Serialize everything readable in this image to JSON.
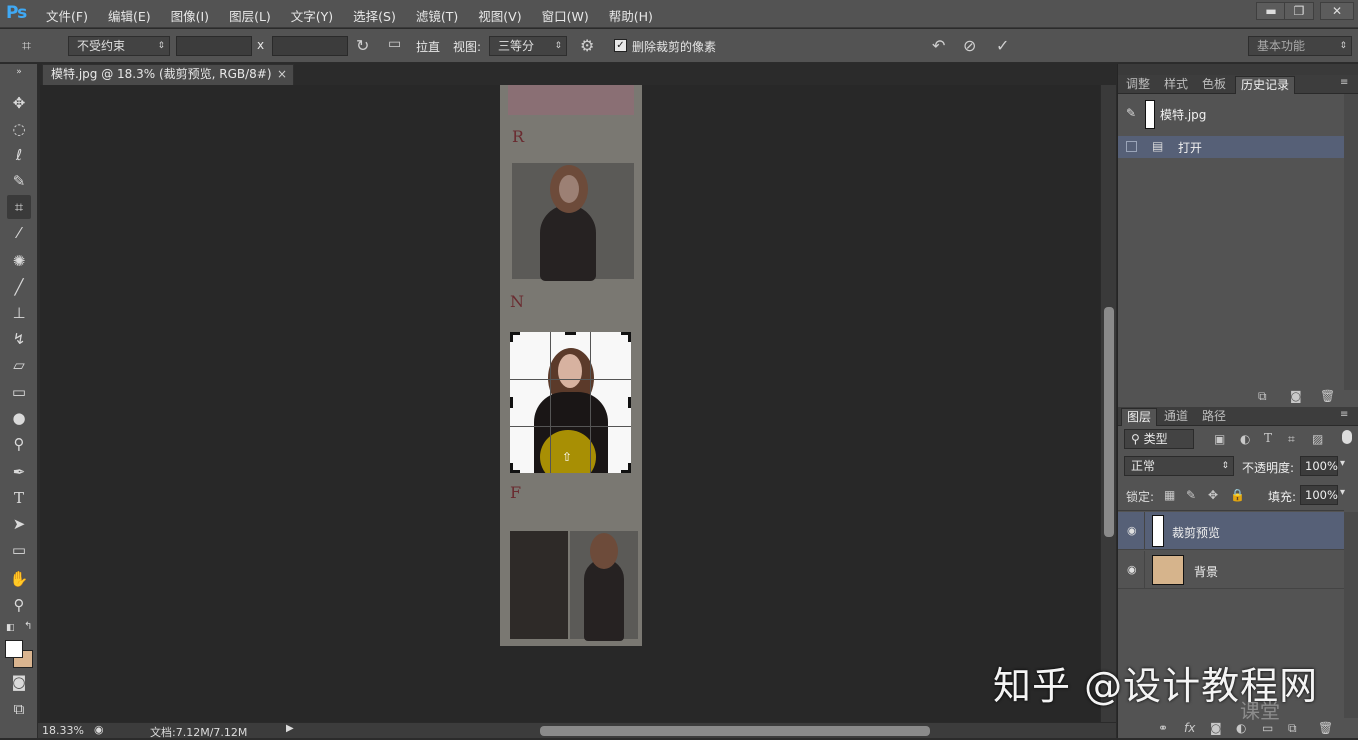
{
  "app": {
    "logo": "Ps"
  },
  "menu": [
    "文件(F)",
    "编辑(E)",
    "图像(I)",
    "图层(L)",
    "文字(Y)",
    "选择(S)",
    "滤镜(T)",
    "视图(V)",
    "窗口(W)",
    "帮助(H)"
  ],
  "window_controls": {
    "minimize": "▬",
    "restore": "❐",
    "close": "✕"
  },
  "options": {
    "ratio_select": "不受约束",
    "width_value": "",
    "separator": "x",
    "height_value": "",
    "straighten_label": "拉直",
    "view_label": "视图:",
    "view_select": "三等分",
    "delete_cropped_label": "删除裁剪的像素",
    "workspace_select": "基本功能"
  },
  "document": {
    "tab_title": "模特.jpg @ 18.3% (裁剪预览, RGB/8#)",
    "tab_close": "×"
  },
  "status": {
    "zoom": "18.33%",
    "doc_info": "文档:7.12M/7.12M"
  },
  "history_panel": {
    "tabs": [
      "调整",
      "样式",
      "色板",
      "历史记录"
    ],
    "snapshot": "模特.jpg",
    "states": [
      "打开"
    ]
  },
  "layers_panel": {
    "tabs": [
      "图层",
      "通道",
      "路径"
    ],
    "filter_kind": "类型",
    "blend_mode": "正常",
    "opacity_label": "不透明度:",
    "opacity_value": "100%",
    "lock_label": "锁定:",
    "fill_label": "填充:",
    "fill_value": "100%",
    "layers": [
      {
        "name": "裁剪预览",
        "selected": true
      },
      {
        "name": "背景",
        "selected": false
      }
    ]
  },
  "watermark": {
    "text": "知乎 @设计教程网",
    "sub": "课堂"
  },
  "colors": {
    "accent": "#3fa9f5",
    "selected_row": "#566077",
    "panel": "#535353",
    "canvas": "#282828"
  }
}
